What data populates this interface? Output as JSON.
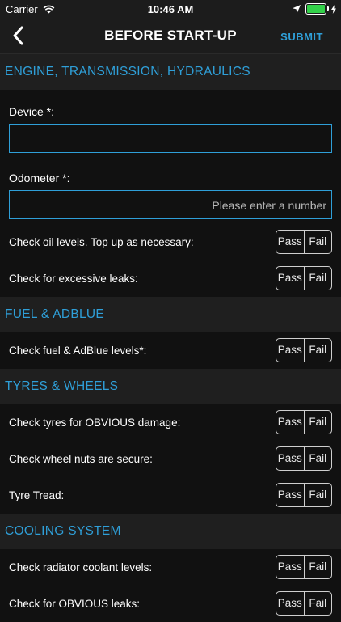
{
  "status": {
    "carrier": "Carrier",
    "time": "10:46 AM"
  },
  "nav": {
    "title": "BEFORE START-UP",
    "submit": "SUBMIT"
  },
  "options": {
    "pass": "Pass",
    "fail": "Fail"
  },
  "sections": [
    {
      "title": "ENGINE, TRANSMISSION, HYDRAULICS",
      "fields": [
        {
          "label": "Device *:",
          "value": "",
          "placeholder": ""
        },
        {
          "label": "Odometer *:",
          "value": "",
          "placeholder": "Please enter a number"
        }
      ],
      "items": [
        "Check oil levels. Top up as necessary:",
        "Check for excessive leaks:"
      ]
    },
    {
      "title": "FUEL & ADBLUE",
      "items": [
        "Check fuel & AdBlue levels*:"
      ]
    },
    {
      "title": "TYRES & WHEELS",
      "items": [
        "Check tyres for OBVIOUS damage:",
        "Check wheel nuts are secure:",
        "Tyre Tread:"
      ]
    },
    {
      "title": "COOLING SYSTEM",
      "items": [
        "Check radiator coolant levels:",
        "Check for OBVIOUS leaks:"
      ]
    }
  ]
}
